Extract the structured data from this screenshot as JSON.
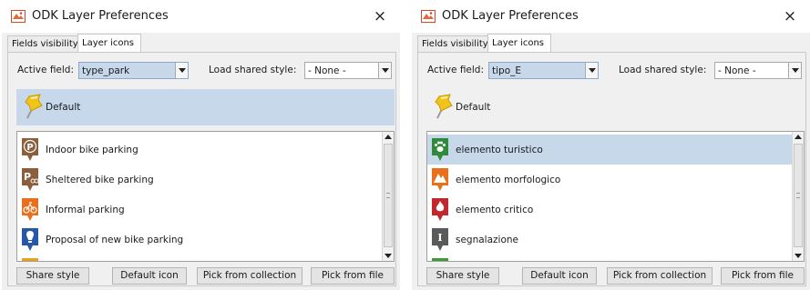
{
  "dialogs": [
    {
      "title": "ODK Layer Preferences",
      "close_glyph": "×",
      "tabs": [
        {
          "label": "Fields visibility"
        },
        {
          "label": "Layer icons",
          "active": true
        }
      ],
      "active_field": {
        "label": "Active field:",
        "value": "type_park"
      },
      "shared_style": {
        "label": "Load shared style:",
        "value": "- None -"
      },
      "default_row": {
        "label": "Default",
        "icon": "yellow-pushpin-icon",
        "selected": true
      },
      "items": [
        {
          "label": "Indoor bike parking",
          "icon": "parking-p-icon",
          "color": "#8b5e3c",
          "selected": false
        },
        {
          "label": "Sheltered bike parking",
          "icon": "parking-bike-icon",
          "color": "#8b5e3c",
          "selected": false
        },
        {
          "label": "Informal parking",
          "icon": "cyclist-icon",
          "color": "#e8701c",
          "selected": false
        },
        {
          "label": "Proposal of new bike parking",
          "icon": "lightbulb-icon",
          "color": "#2757a8",
          "selected": false
        },
        {
          "label": "",
          "icon": "partial-marker-icon",
          "color": "#e8a21c",
          "selected": false
        }
      ],
      "buttons": {
        "share": "Share style",
        "default_icon": "Default icon",
        "collection": "Pick from collection",
        "file": "Pick from file"
      }
    },
    {
      "title": "ODK Layer Preferences",
      "close_glyph": "×",
      "tabs": [
        {
          "label": "Fields visibility"
        },
        {
          "label": "Layer icons",
          "active": true
        }
      ],
      "active_field": {
        "label": "Active field:",
        "value": "tipo_E"
      },
      "shared_style": {
        "label": "Load shared style:",
        "value": "- None -"
      },
      "default_row": {
        "label": "Default",
        "icon": "yellow-pushpin-icon",
        "selected": false
      },
      "items": [
        {
          "label": "elemento turistico",
          "icon": "paw-icon",
          "color": "#2f8a3b",
          "selected": true
        },
        {
          "label": "elemento morfologico",
          "icon": "landscape-icon",
          "color": "#e8701c",
          "selected": false
        },
        {
          "label": "elemento critico",
          "icon": "fire-icon",
          "color": "#c0282d",
          "selected": false
        },
        {
          "label": "segnalazione",
          "icon": "info-i-icon",
          "color": "#5a5a5a",
          "selected": false
        },
        {
          "label": "",
          "icon": "partial-marker-icon",
          "color": "#3f9a3a",
          "selected": false
        }
      ],
      "buttons": {
        "share": "Share style",
        "default_icon": "Default icon",
        "collection": "Pick from collection",
        "file": "Pick from file"
      }
    }
  ],
  "colors": {
    "selection": "#c7d8eb",
    "dialog_bg": "#f0f0f0",
    "pin": "#f2c318"
  }
}
